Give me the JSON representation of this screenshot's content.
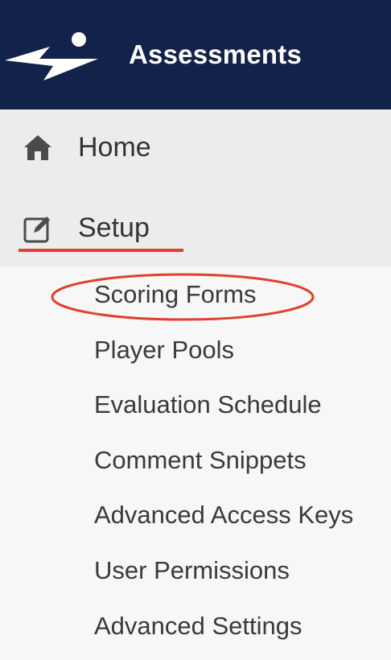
{
  "header": {
    "title": "Assessments",
    "logo_icon": "lightning-bolt-runner-logo",
    "background": "#13224a"
  },
  "nav": {
    "home": {
      "label": "Home",
      "icon": "home-icon"
    },
    "setup": {
      "label": "Setup",
      "icon": "edit-square-icon",
      "expanded": true,
      "expand_icon": "chevron-up-icon"
    }
  },
  "submenu": {
    "items": [
      "Scoring Forms",
      "Player Pools",
      "Evaluation Schedule",
      "Comment Snippets",
      "Advanced Access Keys",
      "User Permissions",
      "Advanced Settings"
    ]
  },
  "annotations": {
    "highlight_color": "#e0412c",
    "highlighted_item": "Scoring Forms",
    "underlined_item": "Setup"
  }
}
